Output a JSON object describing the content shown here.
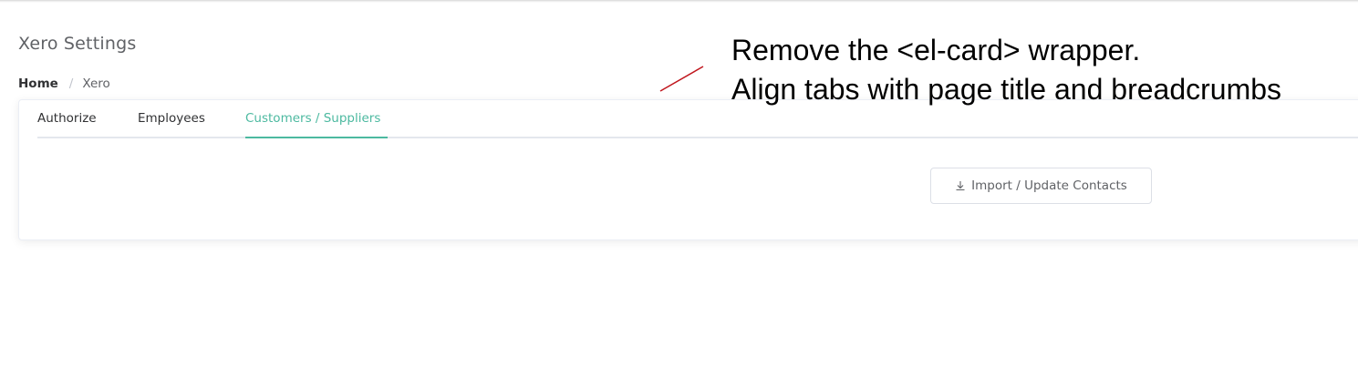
{
  "page": {
    "title": "Xero Settings"
  },
  "breadcrumb": {
    "home": "Home",
    "separator": "/",
    "current": "Xero"
  },
  "tabs": [
    {
      "label": "Authorize",
      "active": false
    },
    {
      "label": "Employees",
      "active": false
    },
    {
      "label": "Customers / Suppliers",
      "active": true
    }
  ],
  "actions": {
    "import_label": "Import / Update Contacts",
    "import_icon": "download-icon"
  },
  "annotation": {
    "line1": "Remove the <el-card> wrapper.",
    "line2": "Align tabs with page title and breadcrumbs",
    "color": "#c0161d"
  },
  "colors": {
    "accent": "#4cb9a0",
    "text": "#303133",
    "muted": "#606266"
  }
}
